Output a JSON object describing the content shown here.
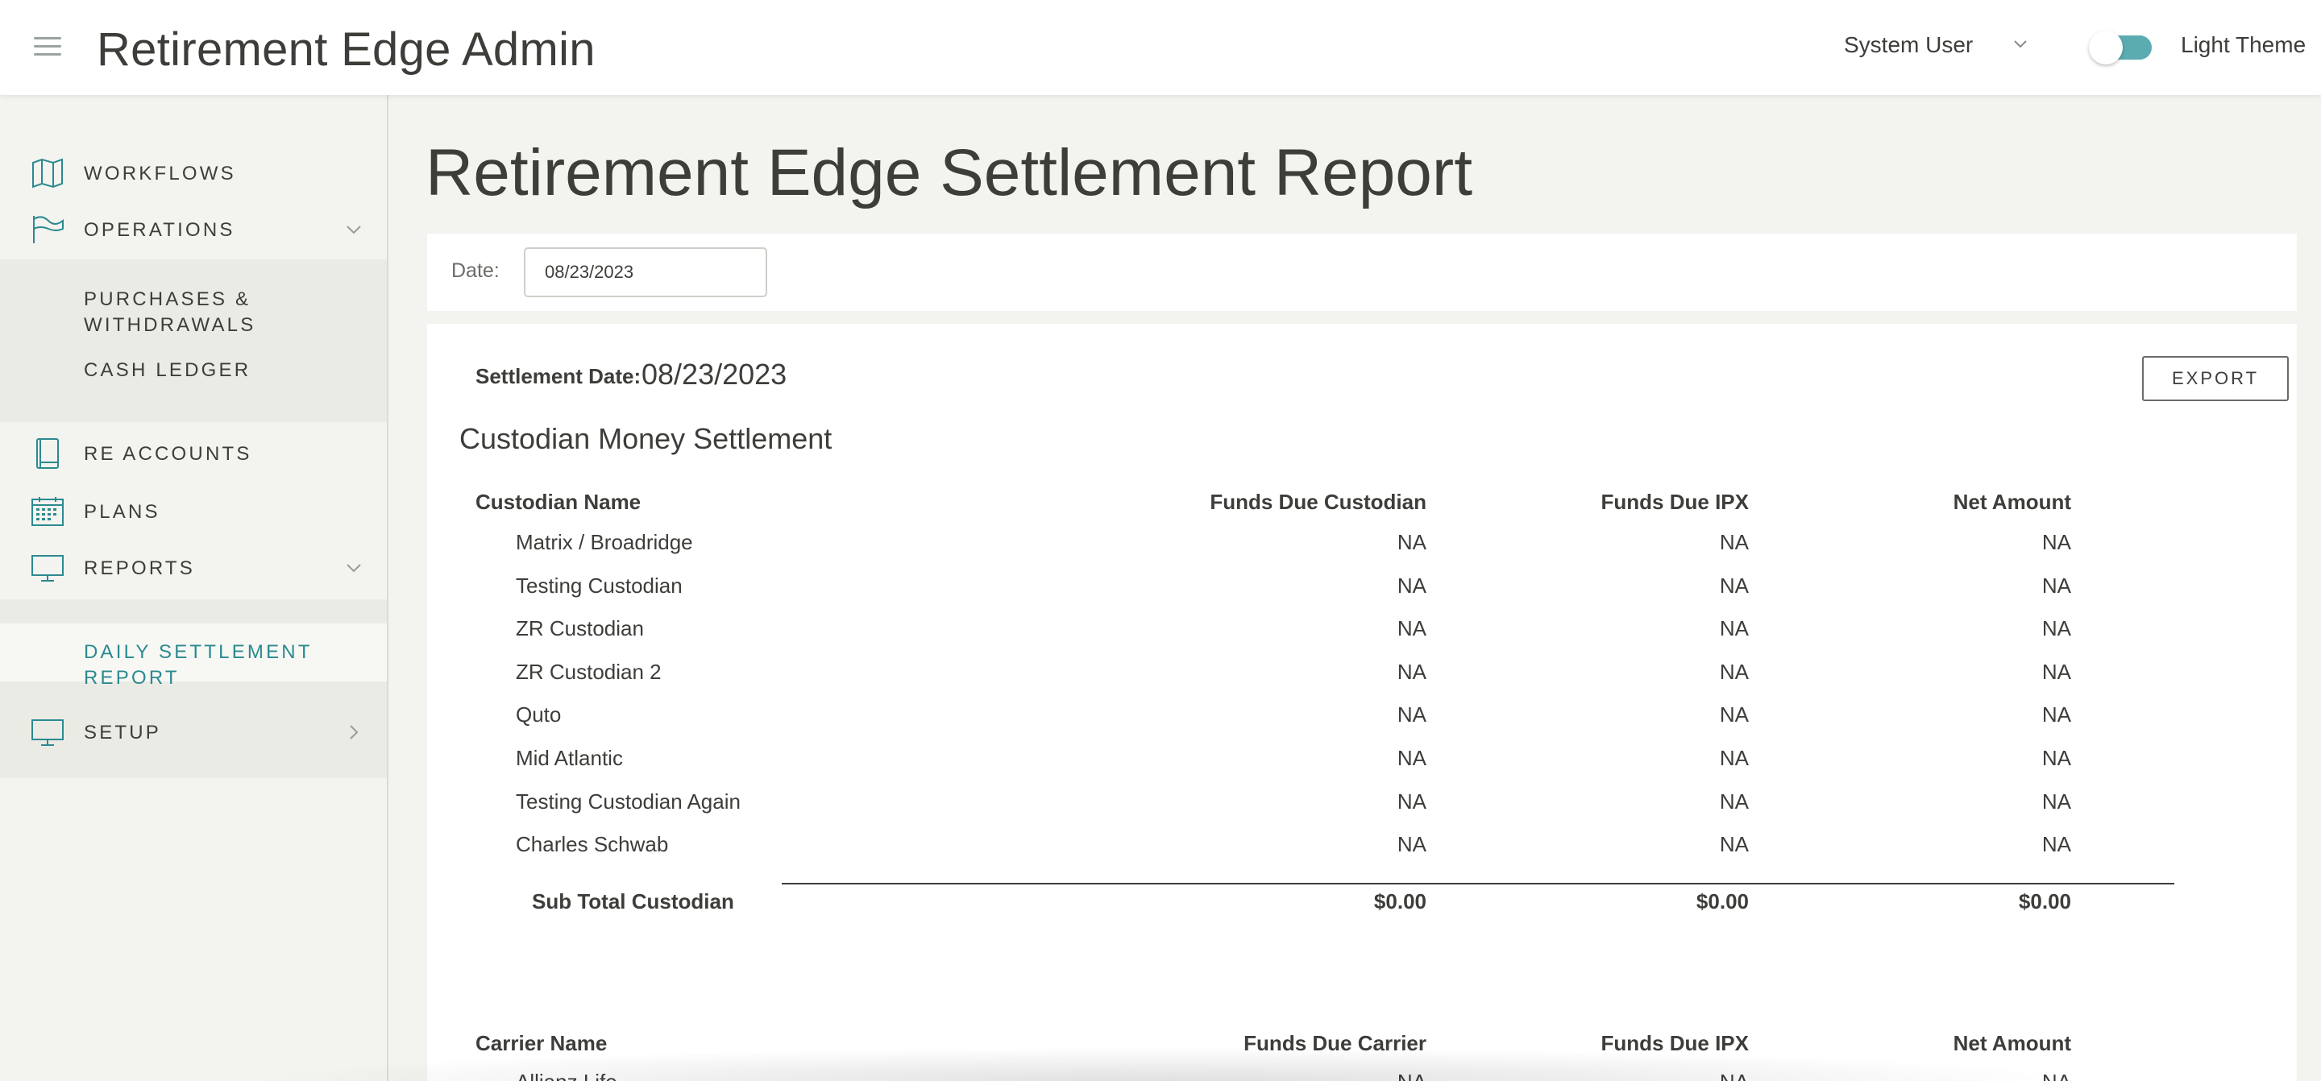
{
  "header": {
    "app_title": "Retirement Edge Admin",
    "user_name": "System User",
    "theme_label": "Light Theme",
    "theme_toggle_on": true
  },
  "sidebar": {
    "items": [
      {
        "label": "WORKFLOWS",
        "icon": "map-icon"
      },
      {
        "label": "OPERATIONS",
        "icon": "flag-icon",
        "expanded": true
      },
      {
        "label": "RE ACCOUNTS",
        "icon": "book-icon"
      },
      {
        "label": "PLANS",
        "icon": "calendar-icon"
      },
      {
        "label": "REPORTS",
        "icon": "monitor-icon",
        "expanded": true
      },
      {
        "label": "SETUP",
        "icon": "monitor-icon",
        "expanded": false
      }
    ],
    "operations_sub": [
      "PURCHASES &",
      "WITHDRAWALS",
      "CASH LEDGER"
    ],
    "reports_sub": [
      "DAILY SETTLEMENT REPORT"
    ]
  },
  "main": {
    "page_title": "Retirement Edge Settlement Report",
    "date_label": "Date:",
    "date_value": "08/23/2023",
    "settlement_date_label": "Settlement Date:",
    "settlement_date_value": "08/23/2023",
    "export_label": "EXPORT",
    "custodian_section_title": "Custodian Money Settlement",
    "custodian_headers": [
      "Custodian Name",
      "Funds Due Custodian",
      "Funds Due IPX",
      "Net Amount"
    ],
    "custodian_rows": [
      [
        "Matrix / Broadridge",
        "NA",
        "NA",
        "NA"
      ],
      [
        "Testing Custodian",
        "NA",
        "NA",
        "NA"
      ],
      [
        "ZR Custodian",
        "NA",
        "NA",
        "NA"
      ],
      [
        "ZR Custodian 2",
        "NA",
        "NA",
        "NA"
      ],
      [
        "Quto",
        "NA",
        "NA",
        "NA"
      ],
      [
        "Mid Atlantic",
        "NA",
        "NA",
        "NA"
      ],
      [
        "Testing Custodian Again",
        "NA",
        "NA",
        "NA"
      ],
      [
        "Charles Schwab",
        "NA",
        "NA",
        "NA"
      ]
    ],
    "custodian_subtotal": [
      "Sub Total Custodian",
      "$0.00",
      "$0.00",
      "$0.00"
    ],
    "carrier_headers": [
      "Carrier Name",
      "Funds Due Carrier",
      "Funds Due IPX",
      "Net Amount"
    ],
    "carrier_rows": [
      [
        "Allianz Life",
        "NA",
        "NA",
        "NA"
      ]
    ]
  },
  "colors": {
    "accent": "#2b8a8f",
    "toggle_track": "#5aacb0",
    "background": "#f3f3ef",
    "text": "#3d3d3a"
  }
}
